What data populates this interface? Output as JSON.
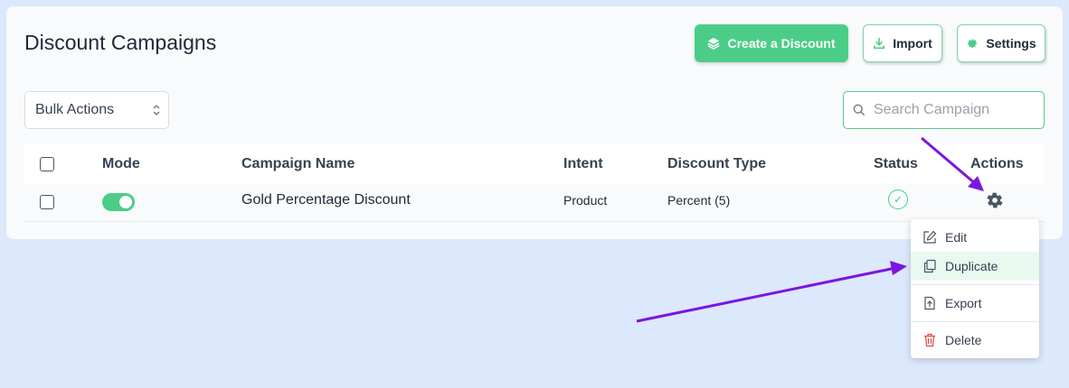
{
  "page": {
    "title": "Discount Campaigns"
  },
  "toolbar": {
    "create_label": "Create a Discount",
    "import_label": "Import",
    "settings_label": "Settings"
  },
  "filters": {
    "bulk_actions": "Bulk Actions",
    "search_placeholder": "Search Campaign"
  },
  "table": {
    "headers": {
      "mode": "Mode",
      "campaign_name": "Campaign Name",
      "intent": "Intent",
      "discount_type": "Discount Type",
      "status": "Status",
      "actions": "Actions"
    },
    "rows": [
      {
        "mode_enabled": true,
        "campaign_name": "Gold Percentage Discount",
        "intent": "Product",
        "discount_type": "Percent (5)",
        "status": "active"
      }
    ]
  },
  "actions_menu": {
    "items": [
      {
        "label": "Edit",
        "icon": "edit-icon"
      },
      {
        "label": "Duplicate",
        "icon": "duplicate-icon",
        "highlighted": true
      },
      {
        "label": "Export",
        "icon": "export-icon"
      },
      {
        "label": "Delete",
        "icon": "trash-icon"
      }
    ]
  },
  "colors": {
    "accent": "#4ccd87",
    "page_background": "#dce8fb",
    "annotation_arrow": "#7b16e0",
    "delete_icon": "#e04848"
  }
}
